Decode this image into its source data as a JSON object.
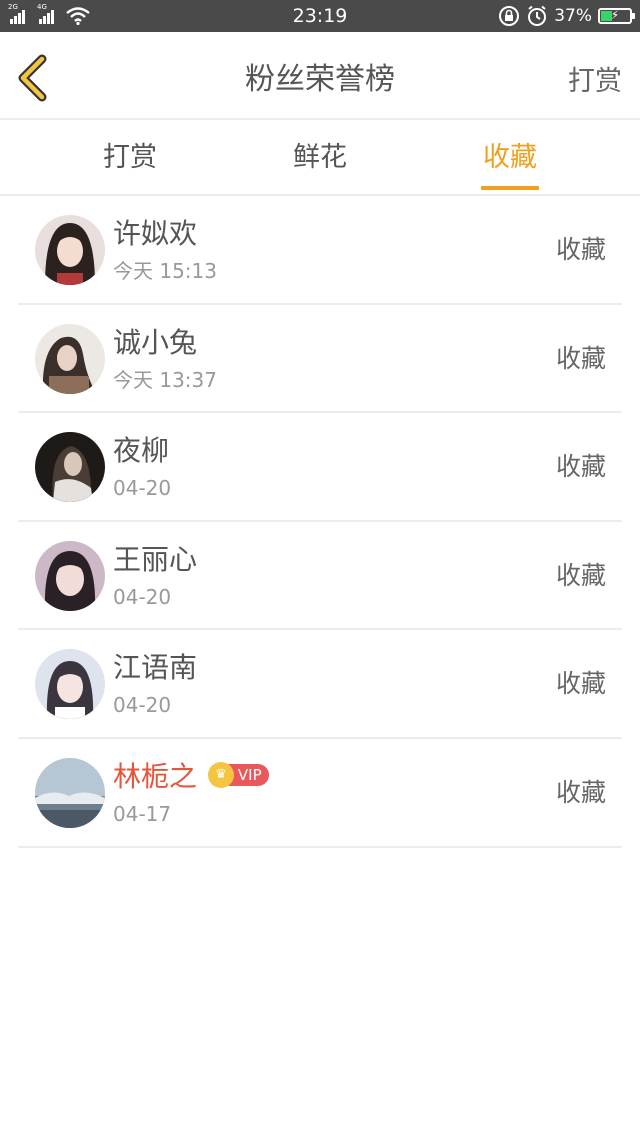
{
  "status_bar": {
    "network_1": "2G",
    "network_2": "4G",
    "time": "23:19",
    "battery_percent": "37%",
    "battery_level": 0.37,
    "icons": [
      "signal-icon",
      "signal-icon",
      "wifi-icon",
      "rotation-lock-icon",
      "alarm-icon",
      "battery-charging-icon"
    ]
  },
  "header": {
    "back_icon": "chevron-left-icon",
    "title": "粉丝荣誉榜",
    "action_label": "打赏",
    "accent_color": "#f0a020"
  },
  "tabs": [
    {
      "label": "打赏",
      "active": false
    },
    {
      "label": "鲜花",
      "active": false
    },
    {
      "label": "收藏",
      "active": true
    }
  ],
  "fans": [
    {
      "name": "许姒欢",
      "time": "今天 15:13",
      "action": "收藏",
      "vip": false
    },
    {
      "name": "诚小兔",
      "time": "今天 13:37",
      "action": "收藏",
      "vip": false
    },
    {
      "name": "夜柳",
      "time": "04-20",
      "action": "收藏",
      "vip": false
    },
    {
      "name": "王丽心",
      "time": "04-20",
      "action": "收藏",
      "vip": false
    },
    {
      "name": "江语南",
      "time": "04-20",
      "action": "收藏",
      "vip": false
    },
    {
      "name": "林栀之",
      "time": "04-17",
      "action": "收藏",
      "vip": true,
      "vip_label": "VIP"
    }
  ]
}
